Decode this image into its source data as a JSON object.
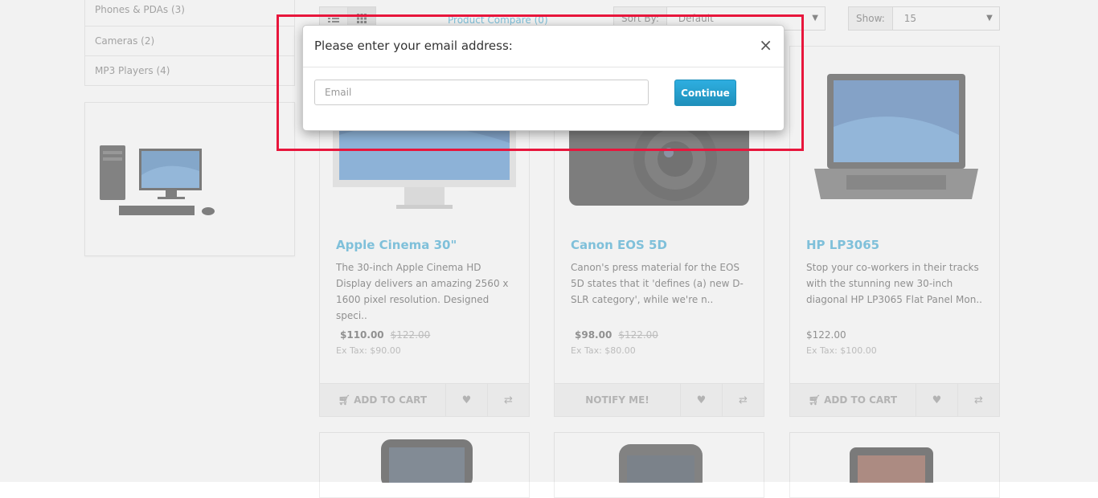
{
  "sidebar": {
    "categories": [
      {
        "label": "Phones & PDAs (3)"
      },
      {
        "label": "Cameras (2)"
      },
      {
        "label": "MP3 Players (4)"
      }
    ]
  },
  "toolbar": {
    "compare_label": "Product Compare (0)",
    "sort_label": "Sort By:",
    "sort_value": "Default",
    "show_label": "Show:",
    "show_value": "15"
  },
  "products": [
    {
      "title": "Apple Cinema 30\"",
      "description": "The 30-inch Apple Cinema HD Display delivers an amazing 2560 x 1600 pixel resolution. Designed speci..",
      "price_new": "$110.00",
      "price_old": "$122.00",
      "tax": "Ex Tax: $90.00",
      "cart_label": "ADD TO CART"
    },
    {
      "title": "Canon EOS 5D",
      "description": "Canon's press material for the EOS 5D states that it 'defines (a) new D-SLR category', while we're n..",
      "price_new": "$98.00",
      "price_old": "$122.00",
      "tax": "Ex Tax: $80.00",
      "cart_label": "NOTIFY ME!"
    },
    {
      "title": "HP LP3065",
      "description": "Stop your co-workers in their tracks with the stunning new 30-inch diagonal HP LP3065 Flat Panel Mon..",
      "price_new": "$122.00",
      "price_old": "",
      "tax": "Ex Tax: $100.00",
      "cart_label": "ADD TO CART"
    }
  ],
  "modal": {
    "title": "Please enter your email address:",
    "close_glyph": "×",
    "email_placeholder": "Email",
    "continue_label": "Continue"
  },
  "colors": {
    "accent": "#23a1d1",
    "highlight": "#e8163c"
  }
}
